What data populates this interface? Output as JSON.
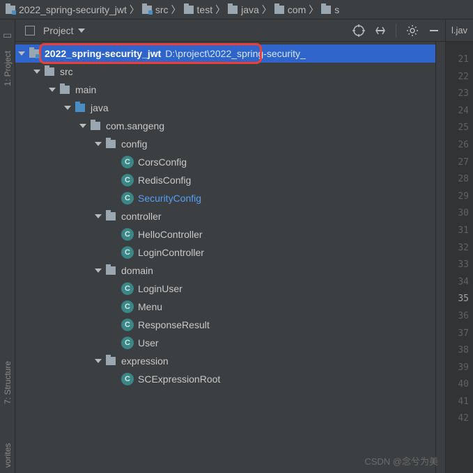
{
  "breadcrumb": [
    {
      "label": "2022_spring-security_jwt",
      "icon": "project"
    },
    {
      "label": "src",
      "icon": "src"
    },
    {
      "label": "test",
      "icon": "folder"
    },
    {
      "label": "java",
      "icon": "folder"
    },
    {
      "label": "com",
      "icon": "folder"
    },
    {
      "label": "s",
      "icon": "folder"
    }
  ],
  "panel": {
    "selector_label": "Project",
    "editor_tab": "l.jav"
  },
  "left_tabs": {
    "project": "1: Project",
    "structure": "7: Structure",
    "favorites": "vorites"
  },
  "tree": {
    "root": {
      "name": "2022_spring-security_jwt",
      "path": "D:\\project\\2022_spring-security_"
    },
    "nodes": [
      {
        "indent": 1,
        "kind": "folder-gray",
        "name": "src",
        "expanded": true
      },
      {
        "indent": 2,
        "kind": "folder-gray",
        "name": "main",
        "expanded": true
      },
      {
        "indent": 3,
        "kind": "folder-blue",
        "name": "java",
        "expanded": true
      },
      {
        "indent": 4,
        "kind": "folder-gray",
        "name": "com.sangeng",
        "expanded": true
      },
      {
        "indent": 5,
        "kind": "folder-gray",
        "name": "config",
        "expanded": true
      },
      {
        "indent": 6,
        "kind": "class",
        "name": "CorsConfig"
      },
      {
        "indent": 6,
        "kind": "class",
        "name": "RedisConfig"
      },
      {
        "indent": 6,
        "kind": "class",
        "name": "SecurityConfig",
        "link": true
      },
      {
        "indent": 5,
        "kind": "folder-gray",
        "name": "controller",
        "expanded": true
      },
      {
        "indent": 6,
        "kind": "class",
        "name": "HelloController"
      },
      {
        "indent": 6,
        "kind": "class",
        "name": "LoginController"
      },
      {
        "indent": 5,
        "kind": "folder-gray",
        "name": "domain",
        "expanded": true
      },
      {
        "indent": 6,
        "kind": "class",
        "name": "LoginUser"
      },
      {
        "indent": 6,
        "kind": "class",
        "name": "Menu"
      },
      {
        "indent": 6,
        "kind": "class",
        "name": "ResponseResult"
      },
      {
        "indent": 6,
        "kind": "class",
        "name": "User"
      },
      {
        "indent": 5,
        "kind": "folder-gray",
        "name": "expression",
        "expanded": true
      },
      {
        "indent": 6,
        "kind": "class",
        "name": "SCExpressionRoot",
        "cut": true
      }
    ]
  },
  "gutter": {
    "lines": [
      21,
      22,
      23,
      24,
      25,
      26,
      27,
      28,
      29,
      30,
      31,
      32,
      33,
      34,
      35,
      36,
      37,
      38,
      39,
      40,
      41,
      42
    ],
    "current": 35
  },
  "watermark": "CSDN @念兮为美"
}
